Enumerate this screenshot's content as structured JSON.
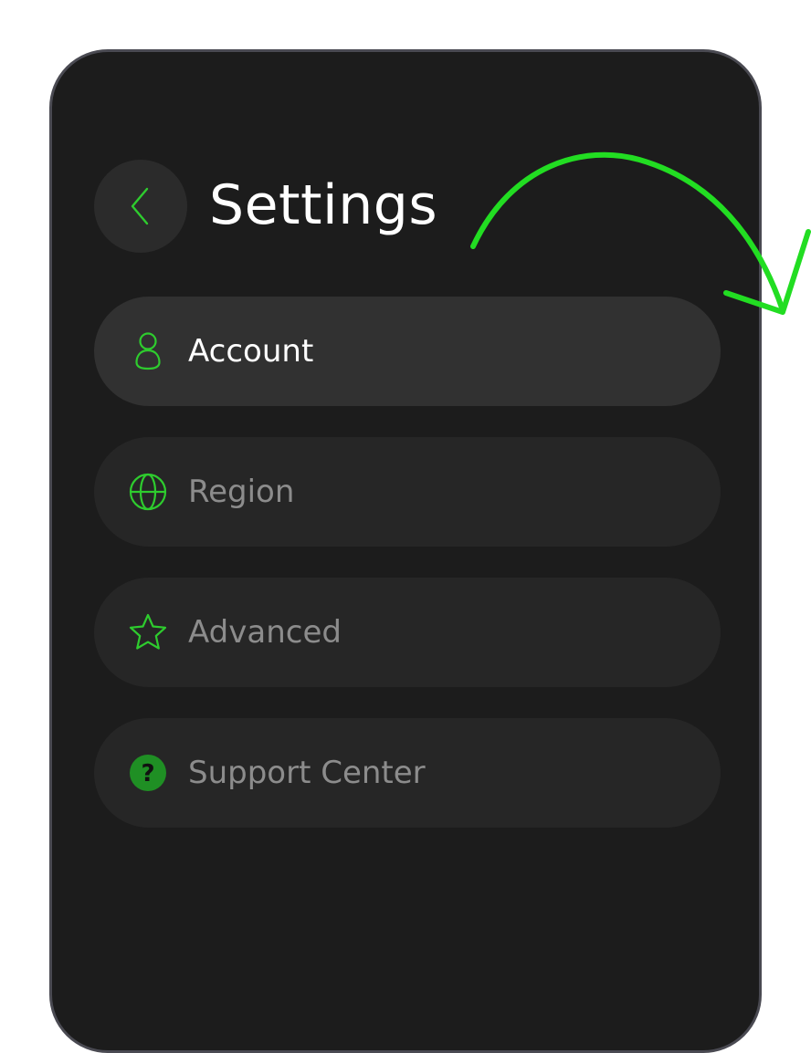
{
  "header": {
    "title": "Settings",
    "back_icon": "chevron-left-icon"
  },
  "menu": {
    "items": [
      {
        "label": "Account",
        "icon": "user-icon",
        "active": true
      },
      {
        "label": "Region",
        "icon": "globe-icon",
        "active": false
      },
      {
        "label": "Advanced",
        "icon": "star-icon",
        "active": false
      },
      {
        "label": "Support Center",
        "icon": "question-circle-icon",
        "active": false
      }
    ]
  },
  "colors": {
    "accent": "#2ecc2e",
    "annotation_arrow": "#22dd22",
    "background": "#1c1c1c",
    "item_background": "#262626",
    "item_active_background": "#313131",
    "text_active": "#ffffff",
    "text_inactive": "#8c8c8c"
  }
}
